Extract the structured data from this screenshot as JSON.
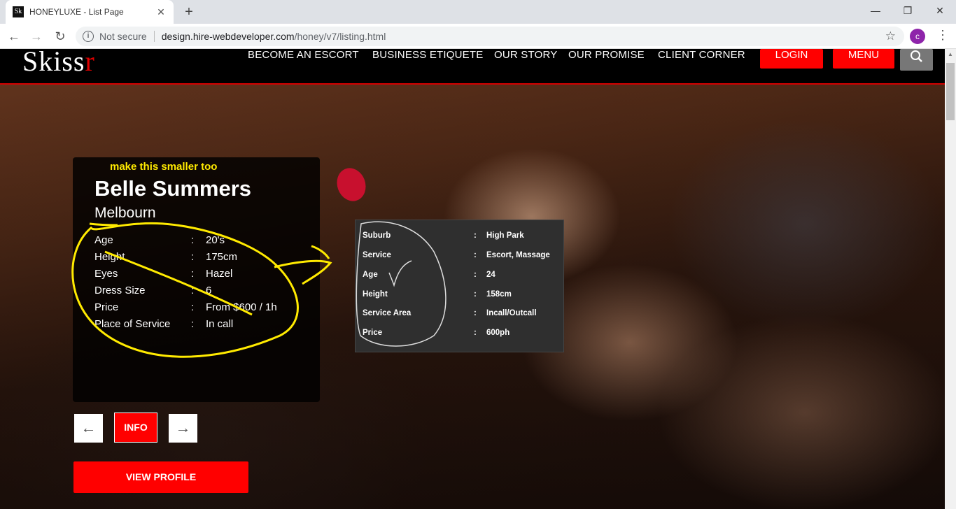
{
  "browser": {
    "tab_title": "HONEYLUXE - List Page",
    "favicon_text": "Sk",
    "security_label": "Not secure",
    "url_host": "design.hire-webdeveloper.com",
    "url_path": "/honey/v7/listing.html",
    "profile_initial": "c"
  },
  "header": {
    "logo_main": "Skiss",
    "logo_accent": "r",
    "nav": [
      "BECOME AN ESCORT",
      "BUSINESS ETIQUETE",
      "OUR STORY",
      "OUR PROMISE",
      "CLIENT CORNER"
    ],
    "login_label": "LOGIN",
    "menu_label": "MENU",
    "accent_color": "#ff0000"
  },
  "card": {
    "annotation_note": "make this smaller too",
    "name": "Belle Summers",
    "city": "Melbourn",
    "attributes": [
      {
        "label": "Age",
        "value": "20's"
      },
      {
        "label": "Height",
        "value": "175cm"
      },
      {
        "label": "Eyes",
        "value": "Hazel"
      },
      {
        "label": "Dress Size",
        "value": "6"
      },
      {
        "label": "Price",
        "value": "From $600 / 1h"
      },
      {
        "label": "Place of Service",
        "value": "In call"
      }
    ],
    "separator": ":"
  },
  "gray_table": {
    "rows": [
      {
        "label": "Suburb",
        "value": "High Park"
      },
      {
        "label": "Service",
        "value": "Escort, Massage"
      },
      {
        "label": "Age",
        "value": "24"
      },
      {
        "label": "Height",
        "value": "158cm"
      },
      {
        "label": "Service Area",
        "value": "Incall/Outcall"
      },
      {
        "label": "Price",
        "value": "600ph"
      }
    ]
  },
  "controls": {
    "info_label": "INFO",
    "view_profile_label": "VIEW PROFILE",
    "prev_icon": "arrow-left",
    "next_icon": "arrow-right"
  }
}
